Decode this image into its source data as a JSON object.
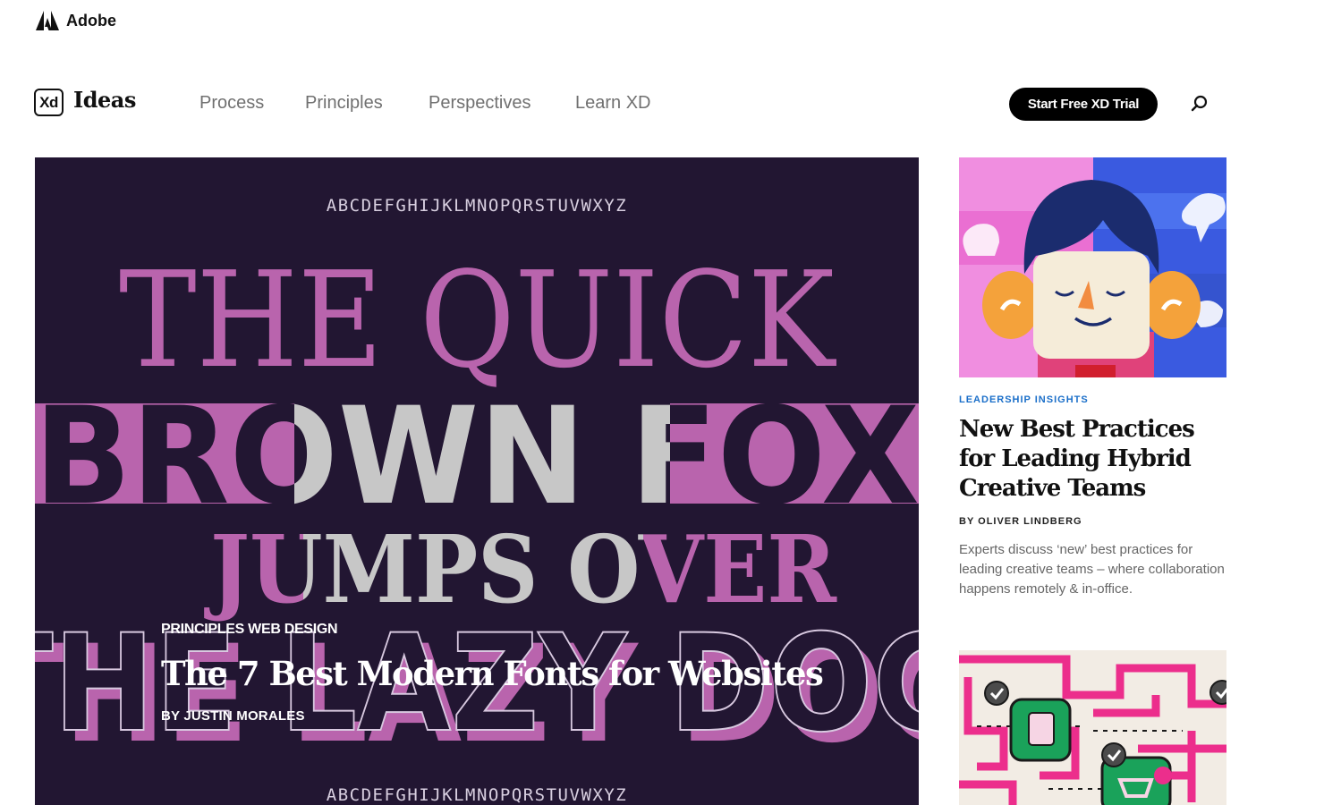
{
  "adobe": {
    "label": "Adobe"
  },
  "nav": {
    "logo_text": "Xd",
    "brand": "Ideas",
    "links": [
      "Process",
      "Principles",
      "Perspectives",
      "Learn XD"
    ],
    "cta_label": "Start Free XD Trial",
    "search_icon": "search-icon"
  },
  "hero": {
    "artwork": {
      "alphabet": "ABCDEFGHIJKLMNOPQRSTUVWXYZ",
      "line1": "THE QUICK",
      "line2": "BROWN FOX",
      "line3": "JUMPS OVER",
      "line4": "THE LAZY DOG"
    },
    "tag": "PRINCIPLES WEB DESIGN",
    "title": "The 7 Best Modern Fonts for Websites",
    "author": "BY JUSTIN MORALES"
  },
  "cards": [
    {
      "tag": "LEADERSHIP INSIGHTS",
      "title": "New Best Practices for Leading Hybrid Creative Teams",
      "author": "BY OLIVER LINDBERG",
      "description": "Experts discuss ‘new’ best practices for leading creative teams – where collaboration happens remotely & in-office."
    }
  ],
  "colors": {
    "hero_bg": "#221632",
    "pink": "#b964ad",
    "gray": "#c7c7c7",
    "tag_blue": "#1b6fc9",
    "cta_bg": "#000000"
  }
}
